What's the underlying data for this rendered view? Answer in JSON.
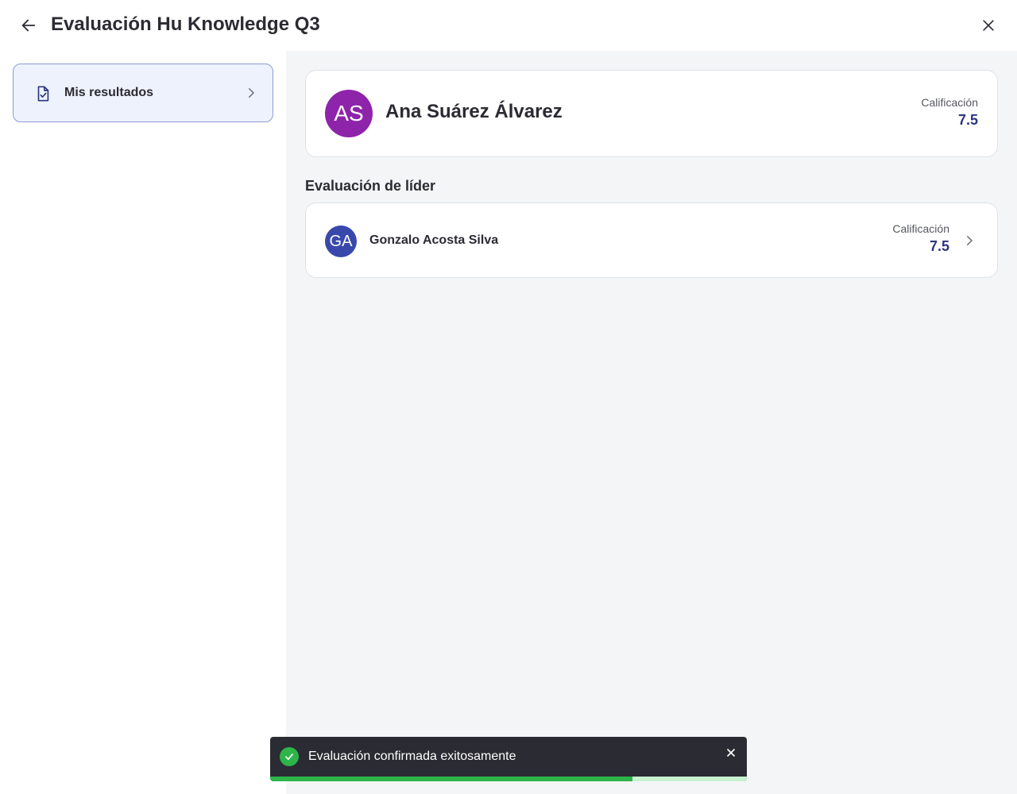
{
  "header": {
    "title": "Evaluación Hu Knowledge Q3"
  },
  "sidebar": {
    "items": [
      {
        "label": "Mis resultados",
        "icon": "document-check-icon"
      }
    ]
  },
  "user_card": {
    "initials": "AS",
    "name": "Ana Suárez Álvarez",
    "grade_label": "Calificación",
    "grade_value": "7.5",
    "avatar_color": "#8e24aa"
  },
  "leader_section": {
    "title": "Evaluación de líder",
    "leader": {
      "initials": "GA",
      "name": "Gonzalo Acosta Silva",
      "grade_label": "Calificación",
      "grade_value": "7.5",
      "avatar_color": "#3949ab"
    }
  },
  "toast": {
    "message": "Evaluación confirmada exitosamente",
    "progress_fraction": 0.76,
    "color": "#2db54a"
  },
  "colors": {
    "accent": "#2c3580",
    "sidebar_selected_bg": "#eef2fc",
    "sidebar_selected_border": "#8d9bd6"
  }
}
